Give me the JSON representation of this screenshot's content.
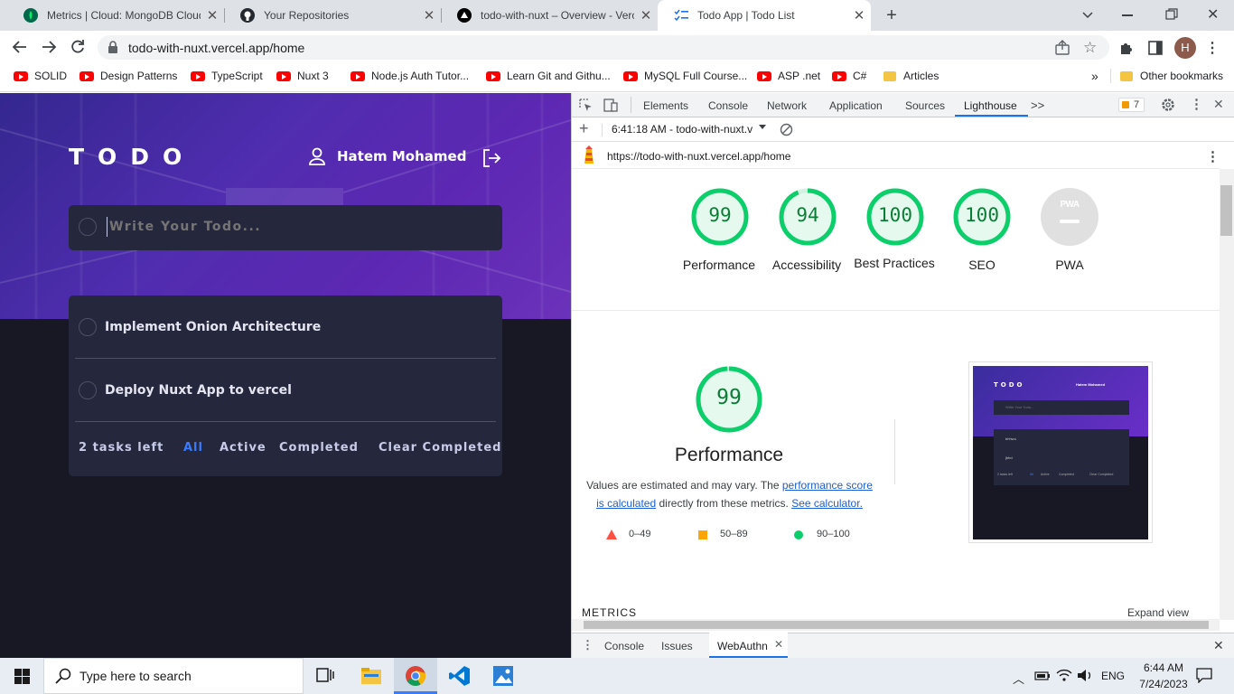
{
  "browser": {
    "tabs": [
      {
        "title": "Metrics | Cloud: MongoDB Cloud",
        "icon": "mongodb-leaf-icon"
      },
      {
        "title": "Your Repositories",
        "icon": "github-icon"
      },
      {
        "title": "todo-with-nuxt – Overview - Verc",
        "icon": "vercel-icon"
      },
      {
        "title": "Todo App | Todo List",
        "icon": "checklist-icon"
      }
    ],
    "url": "todo-with-nuxt.vercel.app/home",
    "profile_initial": "H",
    "bookmarks": [
      "SOLID",
      "Design Patterns",
      "TypeScript",
      "Nuxt 3",
      "Node.js Auth Tutor...",
      "Learn Git and Githu...",
      "MySQL Full Course...",
      "ASP .net",
      "C#"
    ],
    "bookmark_folder": "Articles",
    "other_bookmarks": "Other bookmarks",
    "overflow": "»"
  },
  "todo": {
    "logo": "TODO",
    "user_name": "Hatem Mohamed",
    "input_placeholder": "Write Your Todo...",
    "items": [
      {
        "text": "Implement Onion Architecture",
        "completed": false
      },
      {
        "text": "Deploy Nuxt App to vercel",
        "completed": false
      }
    ],
    "tasks_left": "2 tasks left",
    "filters": [
      "All",
      "Active",
      "Completed"
    ],
    "active_filter": "All",
    "clear_completed": "Clear Completed",
    "colors": {
      "accent": "#3a7cfd",
      "panel": "#25273d",
      "bg": "#171823"
    }
  },
  "devtools": {
    "tabs": [
      "Elements",
      "Console",
      "Network",
      "Application",
      "Sources",
      "Lighthouse"
    ],
    "active_tab": "Lighthouse",
    "more": ">>",
    "issues_count": "7",
    "report_time": "6:41:18 AM - todo-with-nuxt.v",
    "report_url": "https://todo-with-nuxt.vercel.app/home",
    "scores": [
      {
        "label": "Performance",
        "value": 99
      },
      {
        "label": "Accessibility",
        "value": 94
      },
      {
        "label": "Best Practices",
        "value": 100
      },
      {
        "label": "SEO",
        "value": 100
      },
      {
        "label": "PWA",
        "value": null
      }
    ],
    "pwa_badge": "PWA",
    "perf_title": "Performance",
    "perf_score": "99",
    "perf_note_1": "Values are estimated and may vary. The ",
    "perf_link_1": "performance score is calculated",
    "perf_note_2": " directly from these metrics. ",
    "perf_link_2": "See calculator.",
    "legend": [
      "0–49",
      "50–89",
      "90–100"
    ],
    "metrics_heading": "METRICS",
    "expand_view": "Expand view",
    "drawer_tabs": [
      "Console",
      "Issues",
      "WebAuthn"
    ],
    "thumb": {
      "logo": "TODO",
      "user": "Hatem Mohamed",
      "placeholder": "Write Your Todo...",
      "items": [
        "bhhwu",
        "jbbd"
      ],
      "footer": "2 tasks left",
      "filters": [
        "All",
        "Active",
        "Completed"
      ],
      "clear": "Clear Completed"
    },
    "colors": {
      "pass": "#0cce6b",
      "average": "#ffa400",
      "fail": "#ff4e42"
    }
  },
  "taskbar": {
    "search_placeholder": "Type here to search",
    "language": "ENG",
    "time": "6:44 AM",
    "date": "7/24/2023"
  }
}
